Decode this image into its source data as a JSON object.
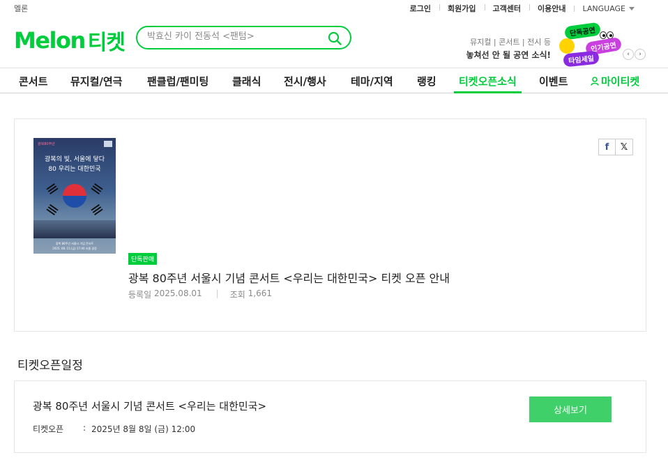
{
  "util": {
    "melon_link": "멜론",
    "links": [
      "로그인",
      "회원가입",
      "고객센터",
      "이용안내"
    ],
    "language": "LANGUAGE"
  },
  "header": {
    "logo_text": "Melon",
    "logo_suffix": "티켓",
    "search_placeholder": "박효신 카이 전동석 <팬텀>",
    "promo_line1": "뮤지컬 | 콘서트 | 전시 등",
    "promo_line2": "놓쳐선 안 될 공연 소식!",
    "badges": [
      "단독공연",
      "인기공연",
      "타임세일"
    ],
    "pager_prev": "‹",
    "pager_next": "›"
  },
  "nav": {
    "items": [
      "콘서트",
      "뮤지컬/연극",
      "팬클럽/팬미팅",
      "클래식",
      "전시/행사",
      "테마/지역",
      "랭킹",
      "티켓오픈소식",
      "이벤트"
    ],
    "active": "티켓오픈소식",
    "my_ticket": "마이티켓",
    "accent_color": "#00cd3c"
  },
  "notice": {
    "poster": {
      "tag": "광복80주년",
      "title_line1": "광복의 빛, 서울에 닿다",
      "title_line2": "80 우리는 대한민국",
      "foot_line1": "광복 80주년 서울시 기념 콘서트",
      "foot_line2": "2025. 08. 15.(금) 17:40 서울 광장"
    },
    "share": {
      "facebook": "f",
      "x": "𝕏"
    },
    "tag": "단독판매",
    "title": "광복 80주년 서울시 기념 콘서트 <우리는 대한민국> 티켓 오픈 안내",
    "date_label": "등록일",
    "date": "2025.08.01",
    "views_label": "조회",
    "views": "1,661"
  },
  "schedule": {
    "heading": "티켓오픈일정",
    "title": "광복 80주년 서울시 기념 콘서트 <우리는 대한민국>",
    "open_label": "티켓오픈",
    "open_value": "2025년 8월 8일 (금) 12:00",
    "detail_button": "상세보기"
  }
}
